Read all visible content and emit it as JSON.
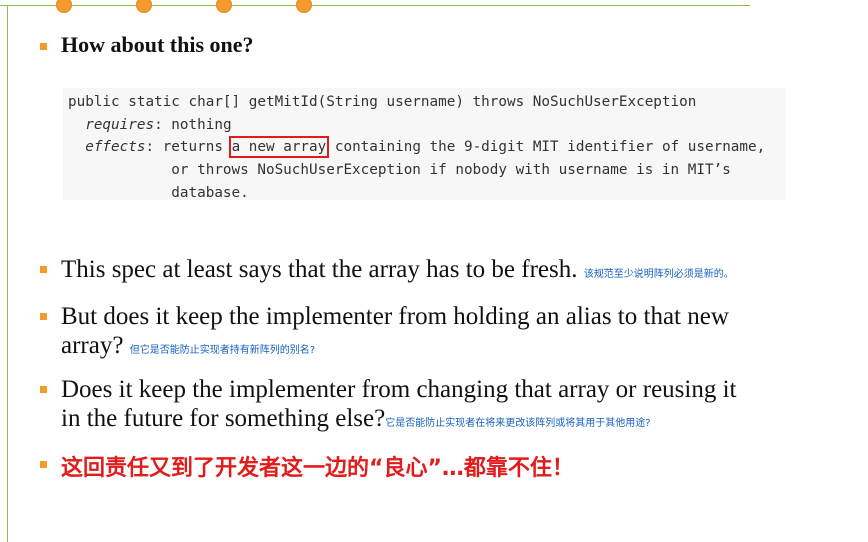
{
  "slide": {
    "heading": "How about this one?",
    "code": {
      "line1": "public static char[] getMitId(String username) throws NoSuchUserException",
      "requires_kw": "requires",
      "requires_rest": ": nothing",
      "effects_kw": "effects",
      "effects_pre": ": returns ",
      "highlight": "a new array",
      "effects_post": " containing the 9-digit MIT identifier of username,",
      "line4": "            or throws NoSuchUserException if nobody with username is in MIT’s",
      "line5": "            database."
    },
    "bullets": [
      {
        "text": "This spec at least says that the array has to be fresh.",
        "note": "该规范至少说明阵列必须是新的。"
      },
      {
        "text_line1": "But does it keep the implementer from holding an alias to that new",
        "text_line2": "array?",
        "note": "但它是否能防止实现者持有新阵列的别名?"
      },
      {
        "text_line1": "Does it keep the implementer from changing that array or reusing it",
        "text_line2": "in the future for something else?",
        "note": "它是否能防止实现者在将来更改该阵列或将其用于其他用途?"
      }
    ],
    "conclusion": "这回责任又到了开发者这一边的“良心”…都靠不住！"
  },
  "colors": {
    "accent_orange": "#f39b2a",
    "line_green": "#8bc34a",
    "highlight_red": "#e21b1b",
    "note_blue": "#1560c0"
  }
}
